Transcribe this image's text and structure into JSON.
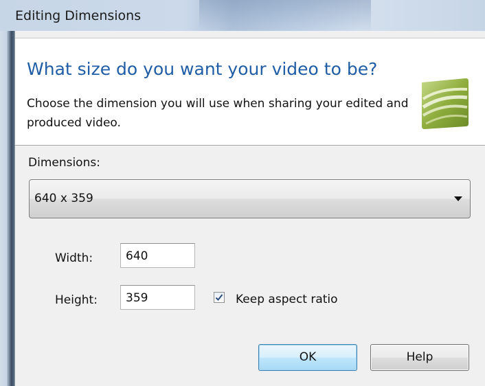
{
  "window": {
    "title": "Editing Dimensions"
  },
  "header": {
    "heading": "What size do you want your video to be?",
    "description": "Choose the dimension you will use when sharing your edited and produced video.",
    "logo_icon": "camtasia-logo-icon"
  },
  "dimensions": {
    "label": "Dimensions:",
    "selected": "640 x 359"
  },
  "fields": {
    "width_label": "Width:",
    "width_value": "640",
    "height_label": "Height:",
    "height_value": "359"
  },
  "keep_aspect": {
    "label": "Keep aspect ratio",
    "checked": true
  },
  "buttons": {
    "ok": "OK",
    "help": "Help"
  },
  "colors": {
    "heading": "#1f5da6",
    "ok_border": "#3c7fb1"
  }
}
